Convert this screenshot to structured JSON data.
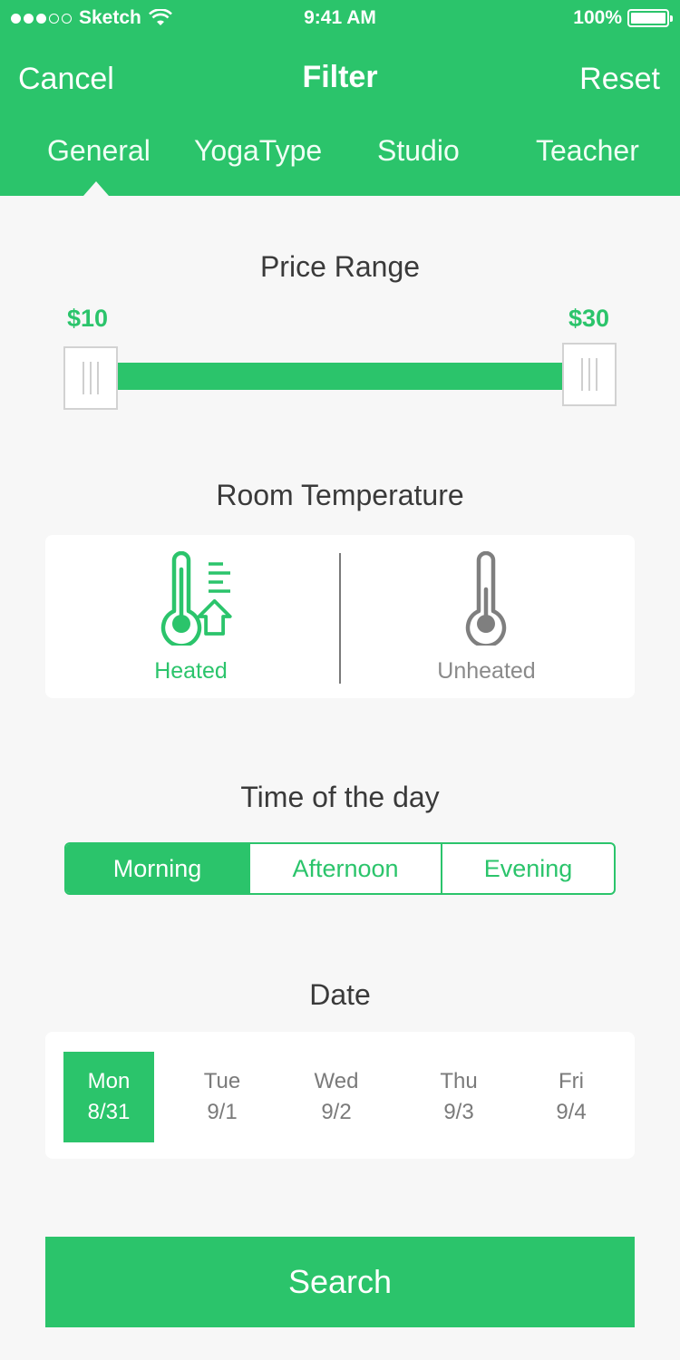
{
  "status_bar": {
    "carrier": "Sketch",
    "time": "9:41 AM",
    "battery": "100%"
  },
  "nav": {
    "cancel": "Cancel",
    "title": "Filter",
    "reset": "Reset"
  },
  "tabs": [
    {
      "label": "General",
      "active": true
    },
    {
      "label": "YogaType",
      "active": false
    },
    {
      "label": "Studio",
      "active": false
    },
    {
      "label": "Teacher",
      "active": false
    }
  ],
  "price": {
    "title": "Price Range",
    "min_label": "$10",
    "max_label": "$30"
  },
  "temperature": {
    "title": "Room Temperature",
    "options": [
      {
        "label": "Heated",
        "icon": "heated-thermometer-icon",
        "selected": true
      },
      {
        "label": "Unheated",
        "icon": "thermometer-icon",
        "selected": false
      }
    ]
  },
  "time_of_day": {
    "title": "Time of the day",
    "options": [
      {
        "label": "Morning",
        "selected": true
      },
      {
        "label": "Afternoon",
        "selected": false
      },
      {
        "label": "Evening",
        "selected": false
      }
    ]
  },
  "date": {
    "title": "Date",
    "days": [
      {
        "day": "Mon",
        "date": "8/31",
        "selected": true
      },
      {
        "day": "Tue",
        "date": "9/1",
        "selected": false
      },
      {
        "day": "Wed",
        "date": "9/2",
        "selected": false
      },
      {
        "day": "Thu",
        "date": "9/3",
        "selected": false
      },
      {
        "day": "Fri",
        "date": "9/4",
        "selected": false
      }
    ]
  },
  "search_button": "Search",
  "colors": {
    "accent": "#2bc46b",
    "background": "#f7f7f7",
    "muted": "#8a8a8a"
  }
}
